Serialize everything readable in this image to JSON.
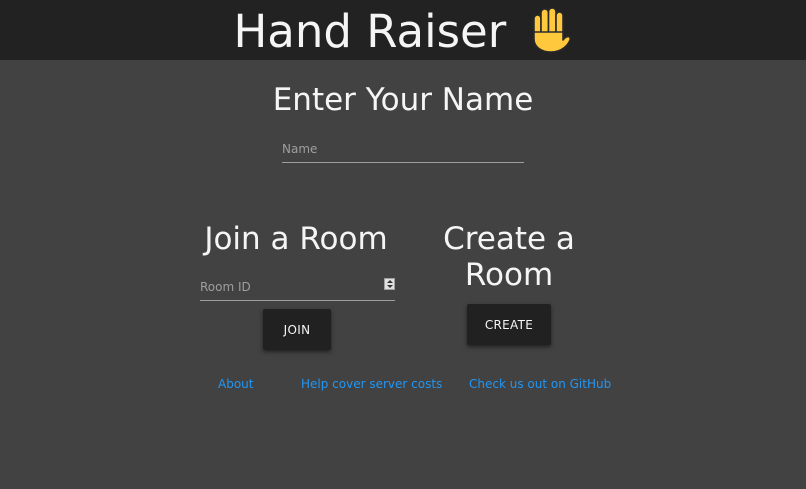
{
  "header": {
    "title": "Hand Raiser",
    "icon": "raised-hand-icon",
    "background_color": "#222222"
  },
  "name_section": {
    "heading": "Enter Your Name",
    "input": {
      "placeholder": "Name",
      "value": ""
    }
  },
  "join_section": {
    "heading": "Join a Room",
    "input": {
      "placeholder": "Room ID",
      "value": ""
    },
    "button_label": "Join"
  },
  "create_section": {
    "heading": "Create a Room",
    "button_label": "Create"
  },
  "footer": {
    "links": [
      {
        "label": "About"
      },
      {
        "label": "Help cover server costs"
      },
      {
        "label": "Check us out on GitHub"
      }
    ]
  },
  "colors": {
    "page_background": "#424242",
    "button_background": "#212121",
    "link": "#2196f3"
  }
}
